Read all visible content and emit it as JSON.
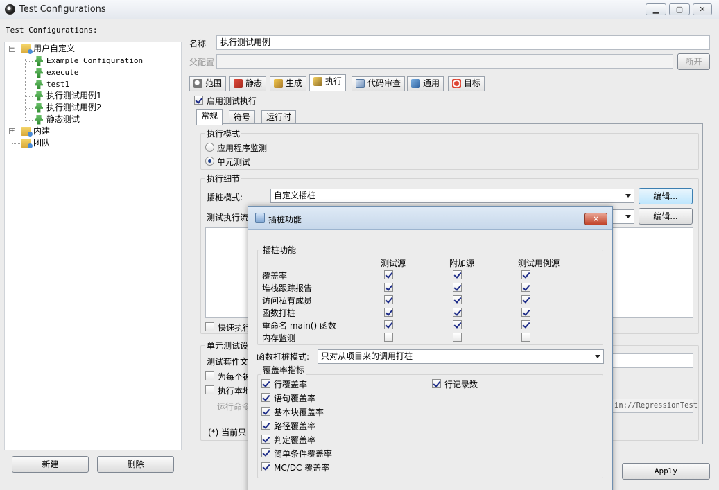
{
  "window": {
    "title": "Test Configurations"
  },
  "left": {
    "header": "Test Configurations:",
    "tree": {
      "user_defined": "用户自定义",
      "children": [
        "Example Configuration",
        "execute",
        "test1",
        "执行测试用例1",
        "执行测试用例2",
        "静态测试"
      ],
      "builtin": "内建",
      "team": "团队"
    },
    "new_button": "新建",
    "delete_button": "删除"
  },
  "form": {
    "name_label": "名称",
    "name_value": "执行测试用例",
    "parent_label": "父配置",
    "parent_value": "",
    "disconnect_button": "断开"
  },
  "tabs": [
    "范围",
    "静态",
    "生成",
    "执行",
    "代码审查",
    "通用",
    "目标"
  ],
  "active_tab": "执行",
  "exec": {
    "enable_label": "启用测试执行",
    "subtabs": [
      "常规",
      "符号",
      "运行时"
    ],
    "mode_group": "执行模式",
    "mode_app": "应用程序监测",
    "mode_unit": "单元测试",
    "detail_group": "执行细节",
    "stub_mode_label": "插桩模式:",
    "stub_mode_value": "自定义插桩",
    "edit_button": "编辑...",
    "flow_label": "测试执行流",
    "edit_button2": "编辑...",
    "quick_exec_label": "快速执行",
    "unit_settings_label": "单元测试设",
    "suite_file_label": "测试套件文",
    "each_label": "为每个被",
    "run_local_label": "执行本地",
    "run_cmd_label": "运行命令",
    "run_cmd_value": "in://RegressionTest",
    "note_label": "(*) 当前只",
    "apply_button": "Apply"
  },
  "dialog": {
    "title": "插桩功能",
    "group_title": "插桩功能",
    "columns": [
      "测试源",
      "附加源",
      "测试用例源"
    ],
    "rows": [
      {
        "label": "覆盖率",
        "checks": [
          true,
          true,
          true
        ]
      },
      {
        "label": "堆栈跟踪报告",
        "checks": [
          true,
          true,
          true
        ]
      },
      {
        "label": "访问私有成员",
        "checks": [
          true,
          true,
          true
        ]
      },
      {
        "label": "函数打桩",
        "checks": [
          true,
          true,
          true
        ]
      },
      {
        "label": "重命名 main() 函数",
        "checks": [
          true,
          true,
          true
        ]
      },
      {
        "label": "内存监测",
        "checks": [
          false,
          false,
          false
        ]
      }
    ],
    "stub_mode_label": "函数打桩模式:",
    "stub_mode_value": "只对从项目来的调用打桩",
    "coverage_group": "覆盖率指标",
    "coverage_items": [
      {
        "label": "行覆盖率",
        "checked": true
      },
      {
        "label": "语句覆盖率",
        "checked": true
      },
      {
        "label": "基本块覆盖率",
        "checked": true
      },
      {
        "label": "路径覆盖率",
        "checked": true
      },
      {
        "label": "判定覆盖率",
        "checked": true
      },
      {
        "label": "简单条件覆盖率",
        "checked": true
      },
      {
        "label": "MC/DC 覆盖率",
        "checked": true
      }
    ],
    "line_count": {
      "label": "行记录数",
      "checked": true
    }
  }
}
